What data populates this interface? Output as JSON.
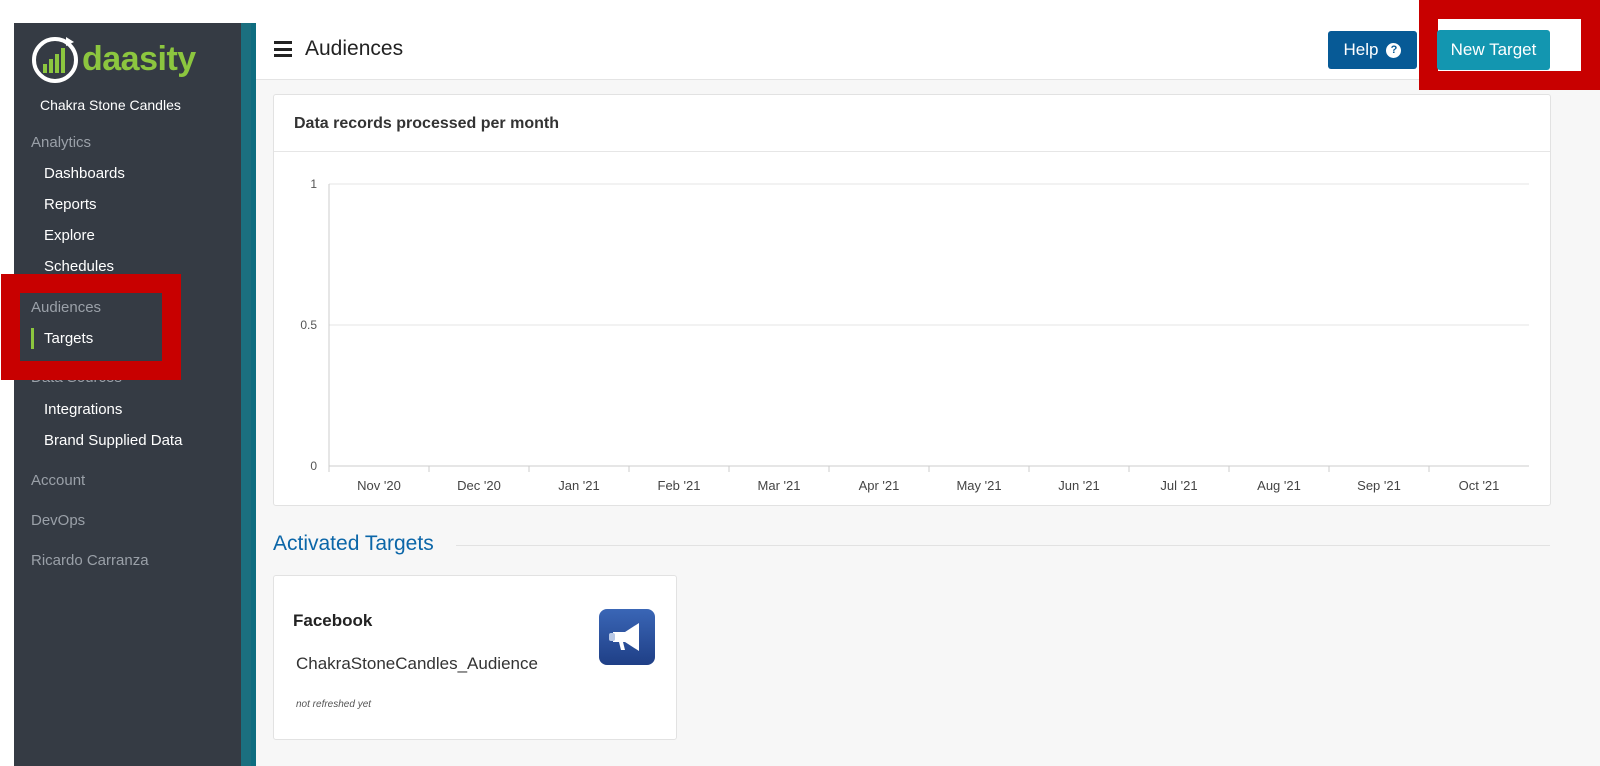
{
  "sidebar": {
    "logo_text": "daasity",
    "org_name": "Chakra Stone Candles",
    "sections": {
      "analytics": "Analytics",
      "audiences": "Audiences",
      "data_sources": "Data Sources",
      "account": "Account",
      "devops": "DevOps",
      "user": "Ricardo Carranza"
    },
    "items": {
      "dashboards": "Dashboards",
      "reports": "Reports",
      "explore": "Explore",
      "schedules": "Schedules",
      "targets": "Targets",
      "integrations": "Integrations",
      "brand_supplied_data": "Brand Supplied Data"
    }
  },
  "header": {
    "title": "Audiences",
    "help_label": "Help",
    "help_icon": "?",
    "new_target_label": "New Target"
  },
  "chart_data": {
    "type": "bar",
    "title": "Data records processed per month",
    "categories": [
      "Nov '20",
      "Dec '20",
      "Jan '21",
      "Feb '21",
      "Mar '21",
      "Apr '21",
      "May '21",
      "Jun '21",
      "Jul '21",
      "Aug '21",
      "Sep '21",
      "Oct '21"
    ],
    "values": [
      0,
      0,
      0,
      0,
      0,
      0,
      0,
      0,
      0,
      0,
      0,
      0
    ],
    "ylim": [
      0,
      1
    ],
    "yticks": [
      "0",
      "0.5",
      "1"
    ],
    "yticks_values": [
      0,
      0.5,
      1
    ],
    "grid": true,
    "xlabel": "",
    "ylabel": ""
  },
  "activated": {
    "title": "Activated Targets",
    "targets": [
      {
        "name": "Facebook",
        "audience": "ChakraStoneCandles_Audience",
        "status": "not refreshed yet",
        "icon": "megaphone-icon"
      }
    ]
  },
  "colors": {
    "sidebar_bg": "#353b44",
    "brand_green": "#8cc63f",
    "help_blue": "#075a96",
    "primary_teal": "#1396b0",
    "annotation_red": "#c80000",
    "link_blue": "#0b66a8"
  }
}
